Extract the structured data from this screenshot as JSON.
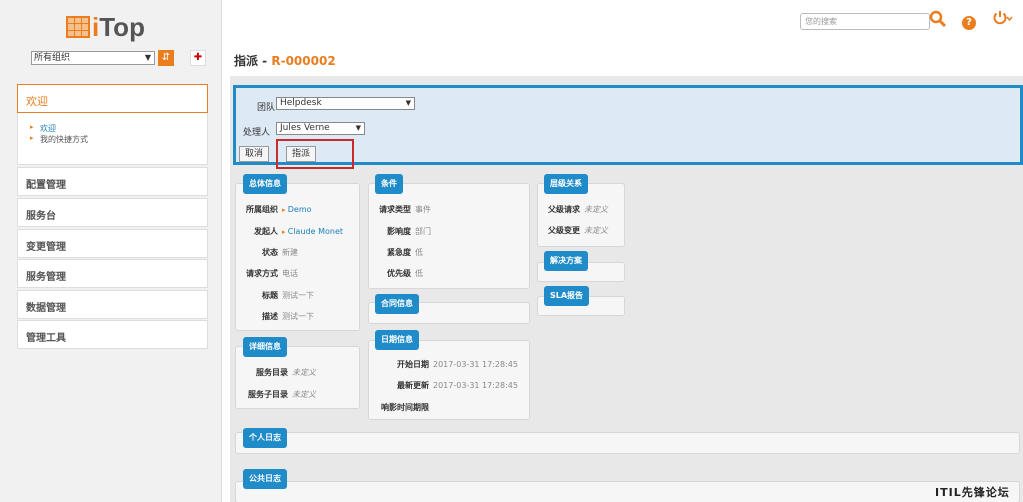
{
  "logo": {
    "text_i": "i",
    "text_rest": "Top"
  },
  "sidebar": {
    "org_select": "所有组织",
    "welcome": "欢迎",
    "welcome_links": [
      "欢迎",
      "我的快捷方式"
    ],
    "menus": [
      "配置管理",
      "服务台",
      "变更管理",
      "服务管理",
      "数据管理",
      "管理工具"
    ]
  },
  "topbar": {
    "search_placeholder": "您的搜索"
  },
  "page": {
    "title_prefix": "指派 - ",
    "title_ref": "R-000002"
  },
  "dispatch": {
    "team_label": "团队",
    "team_value": "Helpdesk",
    "agent_label": "处理人",
    "agent_value": "Jules Verne",
    "cancel_label": "取消",
    "dispatch_label": "指派"
  },
  "panels": {
    "general": {
      "title": "总体信息",
      "rows": [
        {
          "k": "所属组织",
          "v": "Demo"
        },
        {
          "k": "发起人",
          "v": "Claude Monet"
        },
        {
          "k": "状态",
          "v": "新建"
        },
        {
          "k": "请求方式",
          "v": "电话"
        },
        {
          "k": "标题",
          "v": "测试一下"
        },
        {
          "k": "描述",
          "v": "测试一下"
        }
      ]
    },
    "details": {
      "title": "详细信息",
      "rows": [
        {
          "k": "服务目录",
          "v": "未定义"
        },
        {
          "k": "服务子目录",
          "v": "未定义"
        }
      ]
    },
    "conditions": {
      "title": "条件",
      "rows": [
        {
          "k": "请求类型",
          "v": "事件"
        },
        {
          "k": "影响度",
          "v": "部门"
        },
        {
          "k": "紧急度",
          "v": "低"
        },
        {
          "k": "优先级",
          "v": "低"
        }
      ]
    },
    "contract": {
      "title": "合同信息"
    },
    "dates": {
      "title": "日期信息",
      "rows": [
        {
          "k": "开始日期",
          "v": "2017-03-31 17:28:45"
        },
        {
          "k": "最新更新",
          "v": "2017-03-31 17:28:45"
        },
        {
          "k": "响影时间期限",
          "v": ""
        }
      ]
    },
    "relations": {
      "title": "层级关系",
      "rows": [
        {
          "k": "父级请求",
          "v": "未定义"
        },
        {
          "k": "父级变更",
          "v": "未定义"
        }
      ]
    },
    "solution": {
      "title": "解决方案"
    },
    "sla": {
      "title": "SLA报告"
    },
    "private_log": {
      "title": "个人日志"
    },
    "public_log": {
      "title": "公共日志"
    }
  },
  "watermark": "ITIL先锋论坛"
}
